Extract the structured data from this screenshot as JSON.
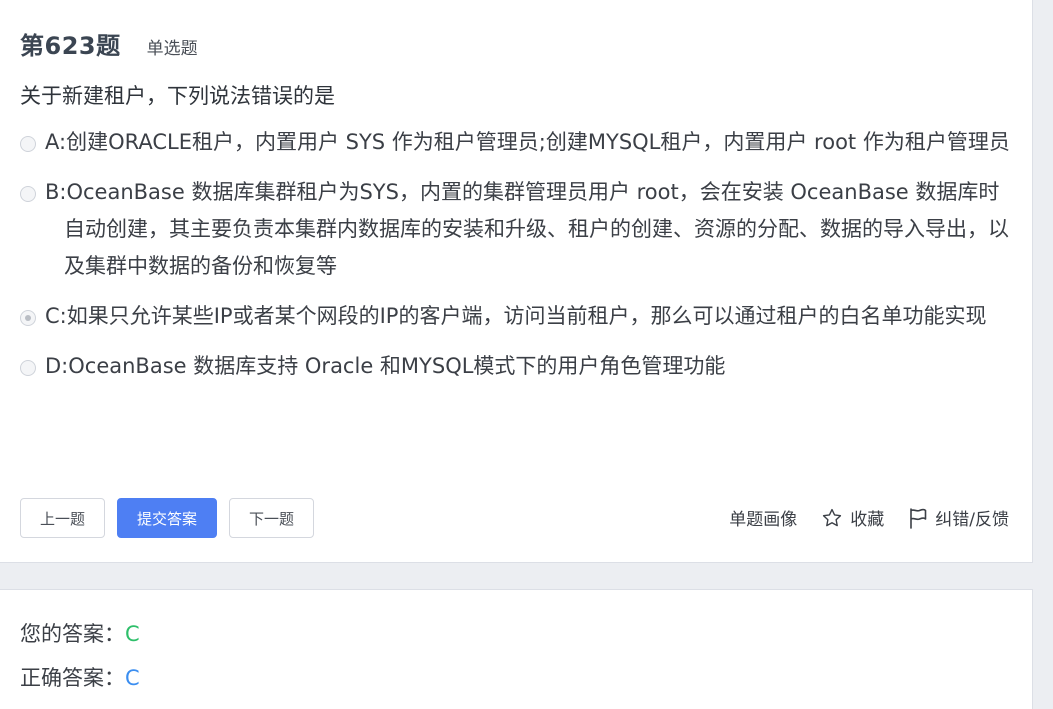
{
  "question": {
    "number": "第623题",
    "type": "单选题",
    "stem": "关于新建租户，下列说法错误的是",
    "options": [
      {
        "text": "A:创建ORACLE租户，内置用户 SYS 作为租户管理员;创建MYSQL租户，内置用户 root 作为租户管理员",
        "checked": false
      },
      {
        "text": "B:OceanBase 数据库集群租户为SYS，内置的集群管理员用户 root，会在安装 OceanBase 数据库时自动创建，其主要负责本集群内数据库的安装和升级、租户的创建、资源的分配、数据的导入导出，以及集群中数据的备份和恢复等",
        "checked": false
      },
      {
        "text": "C:如果只允许某些IP或者某个网段的IP的客户端，访问当前租户，那么可以通过租户的白名单功能实现",
        "checked": true
      },
      {
        "text": "D:OceanBase 数据库支持 Oracle 和MYSQL模式下的用户角色管理功能",
        "checked": false
      }
    ]
  },
  "actions": {
    "prev_label": "上一题",
    "submit_label": "提交答案",
    "next_label": "下一题"
  },
  "tools": {
    "portrait_label": "单题画像",
    "favorite_label": "收藏",
    "feedback_label": "纠错/反馈",
    "favorite_icon": "star-icon",
    "feedback_icon": "flag-icon"
  },
  "answer": {
    "yours_label": "您的答案：",
    "yours_value": "C",
    "correct_label": "正确答案：",
    "correct_value": "C"
  },
  "colors": {
    "primary": "#4e7ff3",
    "your_answer": "#2ebf6a",
    "correct_answer": "#3b8ef0"
  }
}
